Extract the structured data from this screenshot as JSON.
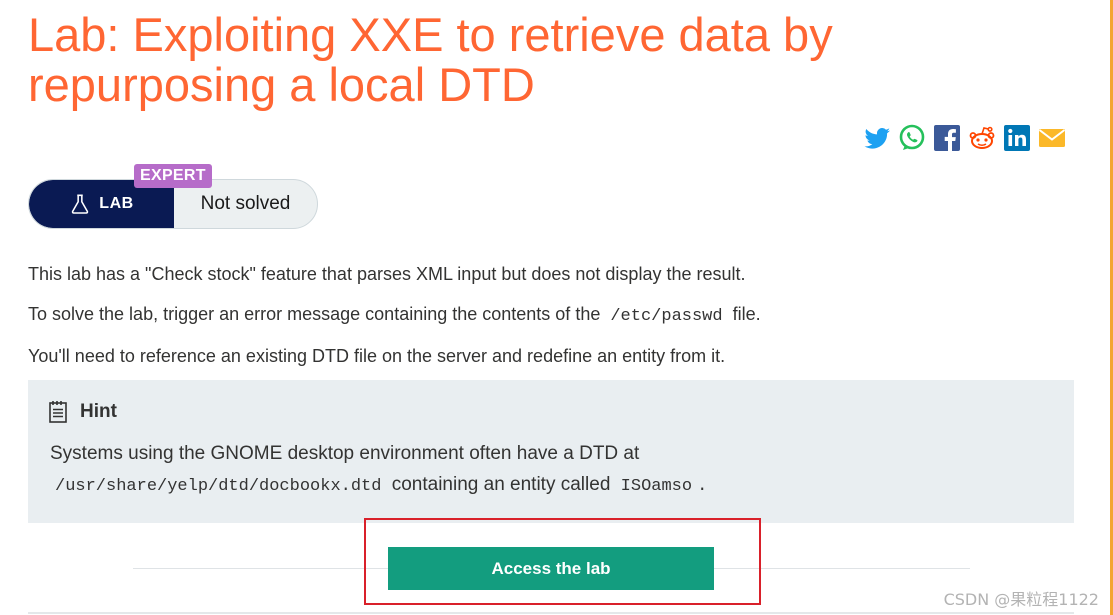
{
  "page": {
    "title": "Lab: Exploiting XXE to retrieve data by repurposing a local DTD"
  },
  "share_icons": [
    "twitter-icon",
    "whatsapp-icon",
    "facebook-icon",
    "reddit-icon",
    "linkedin-icon",
    "email-icon"
  ],
  "lab_badge": {
    "level": "EXPERT",
    "label": "LAB",
    "status": "Not solved"
  },
  "description": {
    "p1": "This lab has a \"Check stock\" feature that parses XML input but does not display the result.",
    "p2_before": "To solve the lab, trigger an error message containing the contents of the",
    "p2_code": "/etc/passwd",
    "p2_after": "file.",
    "p3": "You'll need to reference an existing DTD file on the server and redefine an entity from it."
  },
  "hint": {
    "title": "Hint",
    "line1": "Systems using the GNOME desktop environment often have a DTD at",
    "path_code": "/usr/share/yelp/dtd/docbookx.dtd",
    "line2_mid": "containing an entity called",
    "entity_code": "ISOamso",
    "line2_end": "."
  },
  "actions": {
    "access_label": "Access the lab"
  },
  "watermark": "CSDN @果粒程1122",
  "colors": {
    "title": "#ff6633",
    "lab_dark": "#0a1a53",
    "expert": "#b66cc9",
    "access_button": "#139d7f",
    "highlight_frame": "#d9202a",
    "hint_bg": "#e9eef1"
  }
}
